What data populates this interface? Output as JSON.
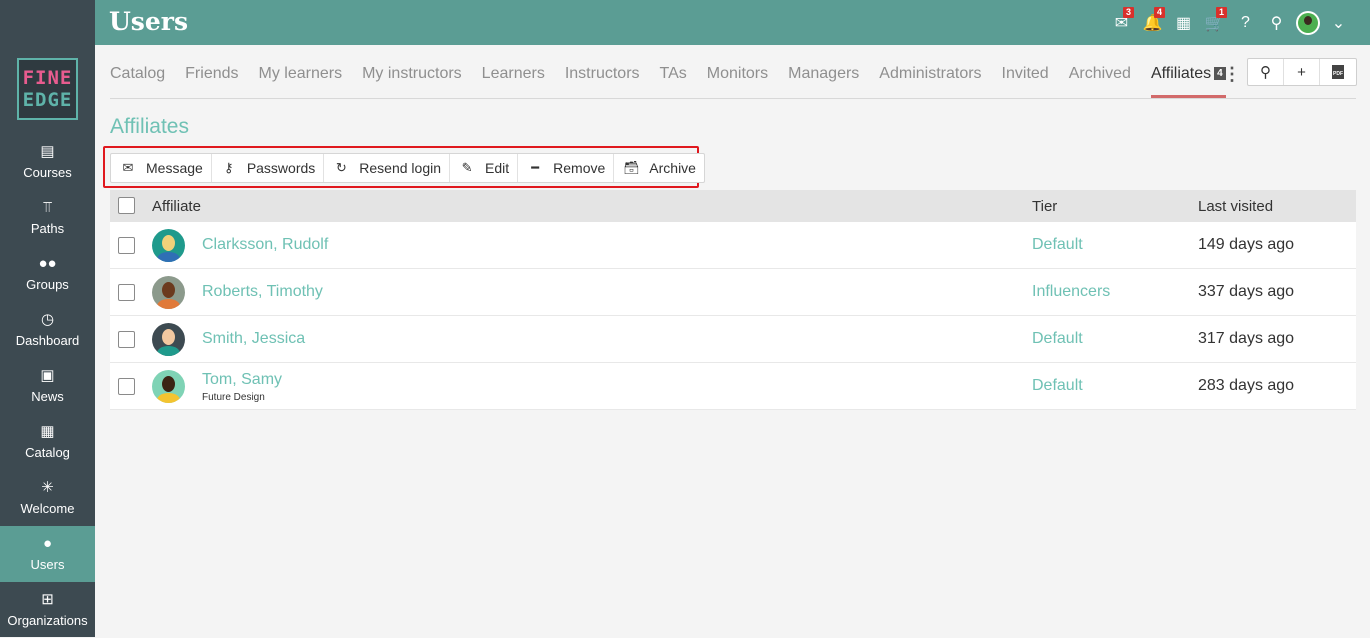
{
  "header": {
    "title": "Users",
    "icons": [
      {
        "name": "messages-icon",
        "badge": "3",
        "glyph": "✉"
      },
      {
        "name": "notifications-icon",
        "badge": "4",
        "glyph": "🔔"
      },
      {
        "name": "calendar-icon",
        "badge": "",
        "glyph": "▦"
      },
      {
        "name": "cart-icon",
        "badge": "1",
        "glyph": "🛒"
      },
      {
        "name": "help-icon",
        "badge": "",
        "glyph": "?"
      },
      {
        "name": "search-icon",
        "badge": "",
        "glyph": "⚲"
      }
    ],
    "chevron": "⌄"
  },
  "logo": {
    "line1": "FINE",
    "line2": "EDGE"
  },
  "sidebar": {
    "items": [
      {
        "label": "Courses",
        "icon": "course-book-icon",
        "glyph": "▤",
        "active": false
      },
      {
        "label": "Paths",
        "icon": "signpost-icon",
        "glyph": "⫪",
        "active": false
      },
      {
        "label": "Groups",
        "icon": "group-icon",
        "glyph": "●●",
        "active": false
      },
      {
        "label": "Dashboard",
        "icon": "gauge-icon",
        "glyph": "◷",
        "active": false
      },
      {
        "label": "News",
        "icon": "newspaper-icon",
        "glyph": "▣",
        "active": false
      },
      {
        "label": "Catalog",
        "icon": "grid-icon",
        "glyph": "▦",
        "active": false
      },
      {
        "label": "Welcome",
        "icon": "sparkle-icon",
        "glyph": "✳",
        "active": false
      },
      {
        "label": "Users",
        "icon": "user-icon",
        "glyph": "●",
        "active": true
      },
      {
        "label": "Organizations",
        "icon": "org-chart-icon",
        "glyph": "⊞",
        "active": false
      }
    ]
  },
  "tabs": {
    "items": [
      "Catalog",
      "Friends",
      "My learners",
      "My instructors",
      "Learners",
      "Instructors",
      "TAs",
      "Monitors",
      "Managers",
      "Administrators",
      "Invited",
      "Archived",
      "Affiliates"
    ],
    "active": "Affiliates",
    "active_count": "4",
    "more": "⋮",
    "tools": [
      {
        "name": "search-icon",
        "glyph": "⚲"
      },
      {
        "name": "add-icon",
        "glyph": "+"
      },
      {
        "name": "pdf-icon",
        "glyph": "PDF"
      }
    ]
  },
  "section": {
    "title": "Affiliates"
  },
  "actions": [
    {
      "label": "Message",
      "icon": "envelope-icon",
      "glyph": "✉"
    },
    {
      "label": "Passwords",
      "icon": "key-icon",
      "glyph": "⚷"
    },
    {
      "label": "Resend login",
      "icon": "refresh-icon",
      "glyph": "↻"
    },
    {
      "label": "Edit",
      "icon": "pencil-icon",
      "glyph": "✎"
    },
    {
      "label": "Remove",
      "icon": "minus-icon",
      "glyph": "━"
    },
    {
      "label": "Archive",
      "icon": "archive-box-icon",
      "glyph": "🗃"
    }
  ],
  "table": {
    "columns": {
      "name": "Affiliate",
      "tier": "Tier",
      "visited": "Last visited"
    },
    "rows": [
      {
        "name": "Clarksson, Rudolf",
        "sub": "",
        "tier": "Default",
        "visited": "149 days ago",
        "avatar_bg": "#1f9a8c",
        "skin": "#f1d17a",
        "shirt": "#2f6fb5"
      },
      {
        "name": "Roberts, Timothy",
        "sub": "",
        "tier": "Influencers",
        "visited": "337 days ago",
        "avatar_bg": "#8c9a8c",
        "skin": "#6b3a1e",
        "shirt": "#e07a3a"
      },
      {
        "name": "Smith, Jessica",
        "sub": "",
        "tier": "Default",
        "visited": "317 days ago",
        "avatar_bg": "#3d4a51",
        "skin": "#f2c8a0",
        "shirt": "#1f9a8c"
      },
      {
        "name": "Tom, Samy",
        "sub": "Future Design",
        "tier": "Default",
        "visited": "283 days ago",
        "avatar_bg": "#7fd3b5",
        "skin": "#3b2414",
        "shirt": "#f4c430"
      }
    ]
  }
}
